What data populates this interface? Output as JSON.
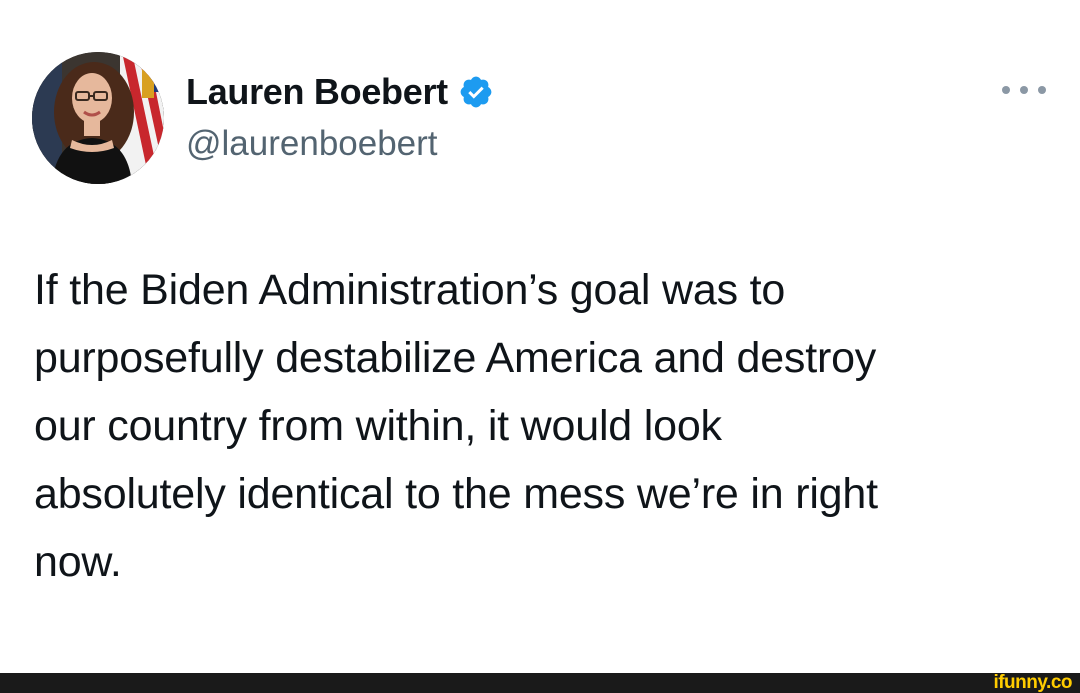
{
  "tweet": {
    "display_name": "Lauren Boebert",
    "handle": "@laurenboebert",
    "verified": true,
    "avatar": "profile-photo",
    "text": "If the Biden Administration’s goal was to\npurposefully destabilize America and destroy\nour country from within, it would look\nabsolutely identical to the mess we’re in right\nnow.",
    "more_icon": "more-horizontal-icon"
  },
  "footer": {
    "watermark": "ifunny.co"
  },
  "colors": {
    "text_primary": "#0f1419",
    "text_secondary": "#536471",
    "verified_blue": "#1d9bf0",
    "footer_bg": "#1a1a1a",
    "watermark": "#ffcc00"
  }
}
